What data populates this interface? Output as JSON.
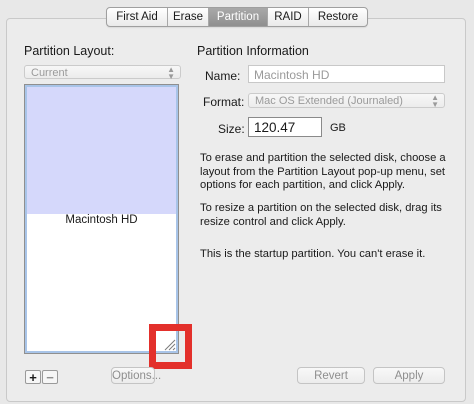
{
  "tabs": [
    "First Aid",
    "Erase",
    "Partition",
    "RAID",
    "Restore"
  ],
  "active_tab": "Partition",
  "partition_layout": {
    "heading": "Partition Layout:",
    "popup_value": "Current",
    "partition_name": "Macintosh HD",
    "used_fraction": 0.48
  },
  "info": {
    "heading": "Partition Information",
    "name_label": "Name:",
    "name_value": "Macintosh HD",
    "format_label": "Format:",
    "format_value": "Mac OS Extended (Journaled)",
    "size_label": "Size:",
    "size_value": "120.47",
    "size_unit": "GB"
  },
  "instructions": [
    "To erase and partition the selected disk, choose a layout from the Partition Layout pop-up menu, set options for each partition, and click Apply.",
    "To resize a partition on the selected disk, drag its resize control and click Apply.",
    "This is the startup partition. You can't erase it."
  ],
  "buttons": {
    "add": "+",
    "remove": "−",
    "options": "Options...",
    "revert": "Revert",
    "apply": "Apply"
  },
  "colors": {
    "highlight": "#e3302b",
    "used_space": "#d5d8fb",
    "active_tab": "#999999"
  }
}
